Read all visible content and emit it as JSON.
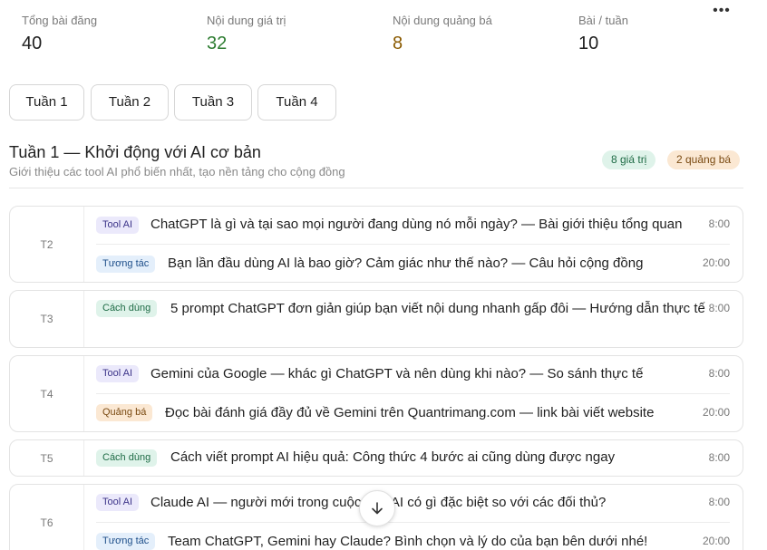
{
  "header": {
    "more_icon": "more-horizontal-icon",
    "more_label": "•••"
  },
  "stats": [
    {
      "label": "Tổng bài đăng",
      "value": "40",
      "color": "default"
    },
    {
      "label": "Nội dung giá trị",
      "value": "32",
      "color": "#2e7d32"
    },
    {
      "label": "Nội dung quảng bá",
      "value": "8",
      "color": "#8a5a00"
    },
    {
      "label": "Bài / tuần",
      "value": "10",
      "color": "default"
    }
  ],
  "tabs": [
    {
      "label": "Tuần 1",
      "active": true
    },
    {
      "label": "Tuần 2",
      "active": false
    },
    {
      "label": "Tuần 3",
      "active": false
    },
    {
      "label": "Tuần 4",
      "active": false
    }
  ],
  "week": {
    "title": "Tuần 1 — Khởi động với AI cơ bản",
    "subtitle": "Giới thiệu các tool AI phổ biến nhất, tạo nền tảng cho cộng đồng",
    "badge_value": "8 giá trị",
    "badge_promo": "2 quảng bá"
  },
  "days": [
    {
      "day": "T2",
      "posts": [
        {
          "tag": "Tool AI",
          "text": "ChatGPT là gì và tại sao mọi người đang dùng nó mỗi ngày? — Bài giới thiệu tổng quan",
          "time": "8:00"
        },
        {
          "tag": "Tương tác",
          "text": "Bạn lần đầu dùng AI là bao giờ? Cảm giác như thế nào? — Câu hỏi cộng đồng",
          "time": "20:00"
        }
      ]
    },
    {
      "day": "T3",
      "posts": [
        {
          "tag": "Cách dùng",
          "text": "5 prompt ChatGPT đơn giản giúp bạn viết nội dung nhanh gấp đôi — Hướng dẫn thực tế",
          "time": "8:00"
        }
      ]
    },
    {
      "day": "T4",
      "posts": [
        {
          "tag": "Tool AI",
          "text": "Gemini của Google — khác gì ChatGPT và nên dùng khi nào? — So sánh thực tế",
          "time": "8:00"
        },
        {
          "tag": "Quảng bá",
          "text": "Đọc bài đánh giá đầy đủ về Gemini trên Quantrimang.com — link bài viết website",
          "time": "20:00"
        }
      ]
    },
    {
      "day": "T5",
      "posts": [
        {
          "tag": "Cách dùng",
          "text": "Cách viết prompt AI hiệu quả: Công thức 4 bước ai cũng dùng được ngay",
          "time": "8:00"
        }
      ]
    },
    {
      "day": "T6",
      "posts": [
        {
          "tag": "Tool AI",
          "text": "Claude AI — người mới trong cuộc đua AI có gì đặc biệt so với các đối thủ?",
          "time": "8:00"
        },
        {
          "tag": "Tương tác",
          "text": "Team ChatGPT, Gemini hay Claude? Bình chọn và lý do của bạn bên dưới nhé!",
          "time": "20:00"
        }
      ]
    }
  ],
  "scroll_button": {
    "icon": "arrow-down-icon"
  }
}
